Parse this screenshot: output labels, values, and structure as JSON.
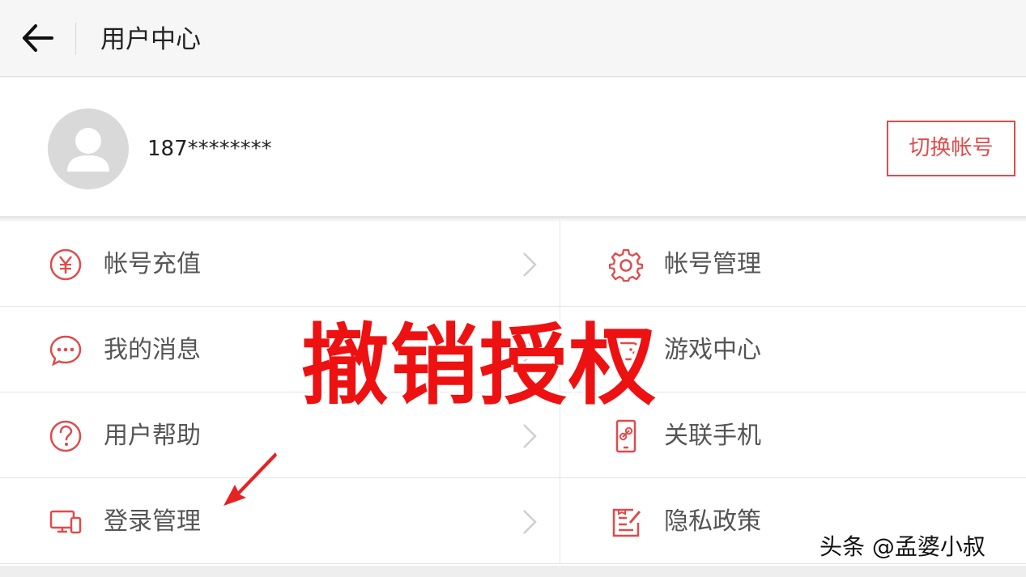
{
  "header": {
    "title": "用户中心",
    "back_icon": "arrow-left-icon"
  },
  "profile": {
    "username": "187********",
    "avatar_icon": "user-avatar-icon",
    "switch_account_label": "切换帐号"
  },
  "menu": {
    "left": [
      {
        "label": "帐号充值",
        "icon": "yen-circle-icon"
      },
      {
        "label": "我的消息",
        "icon": "chat-bubble-icon"
      },
      {
        "label": "用户帮助",
        "icon": "question-circle-icon"
      },
      {
        "label": "登录管理",
        "icon": "devices-icon"
      }
    ],
    "right": [
      {
        "label": "帐号管理",
        "icon": "gear-icon"
      },
      {
        "label": "游戏中心",
        "icon": "game-icon"
      },
      {
        "label": "关联手机",
        "icon": "phone-link-icon"
      },
      {
        "label": "隐私政策",
        "icon": "document-pen-icon"
      }
    ]
  },
  "overlay": {
    "caption": "撤销授权"
  },
  "watermark": {
    "text": "头条 @孟婆小叔"
  },
  "colors": {
    "accent": "#e04b4b",
    "caption_red": "#ee1111",
    "background": "#f4f4f4"
  }
}
